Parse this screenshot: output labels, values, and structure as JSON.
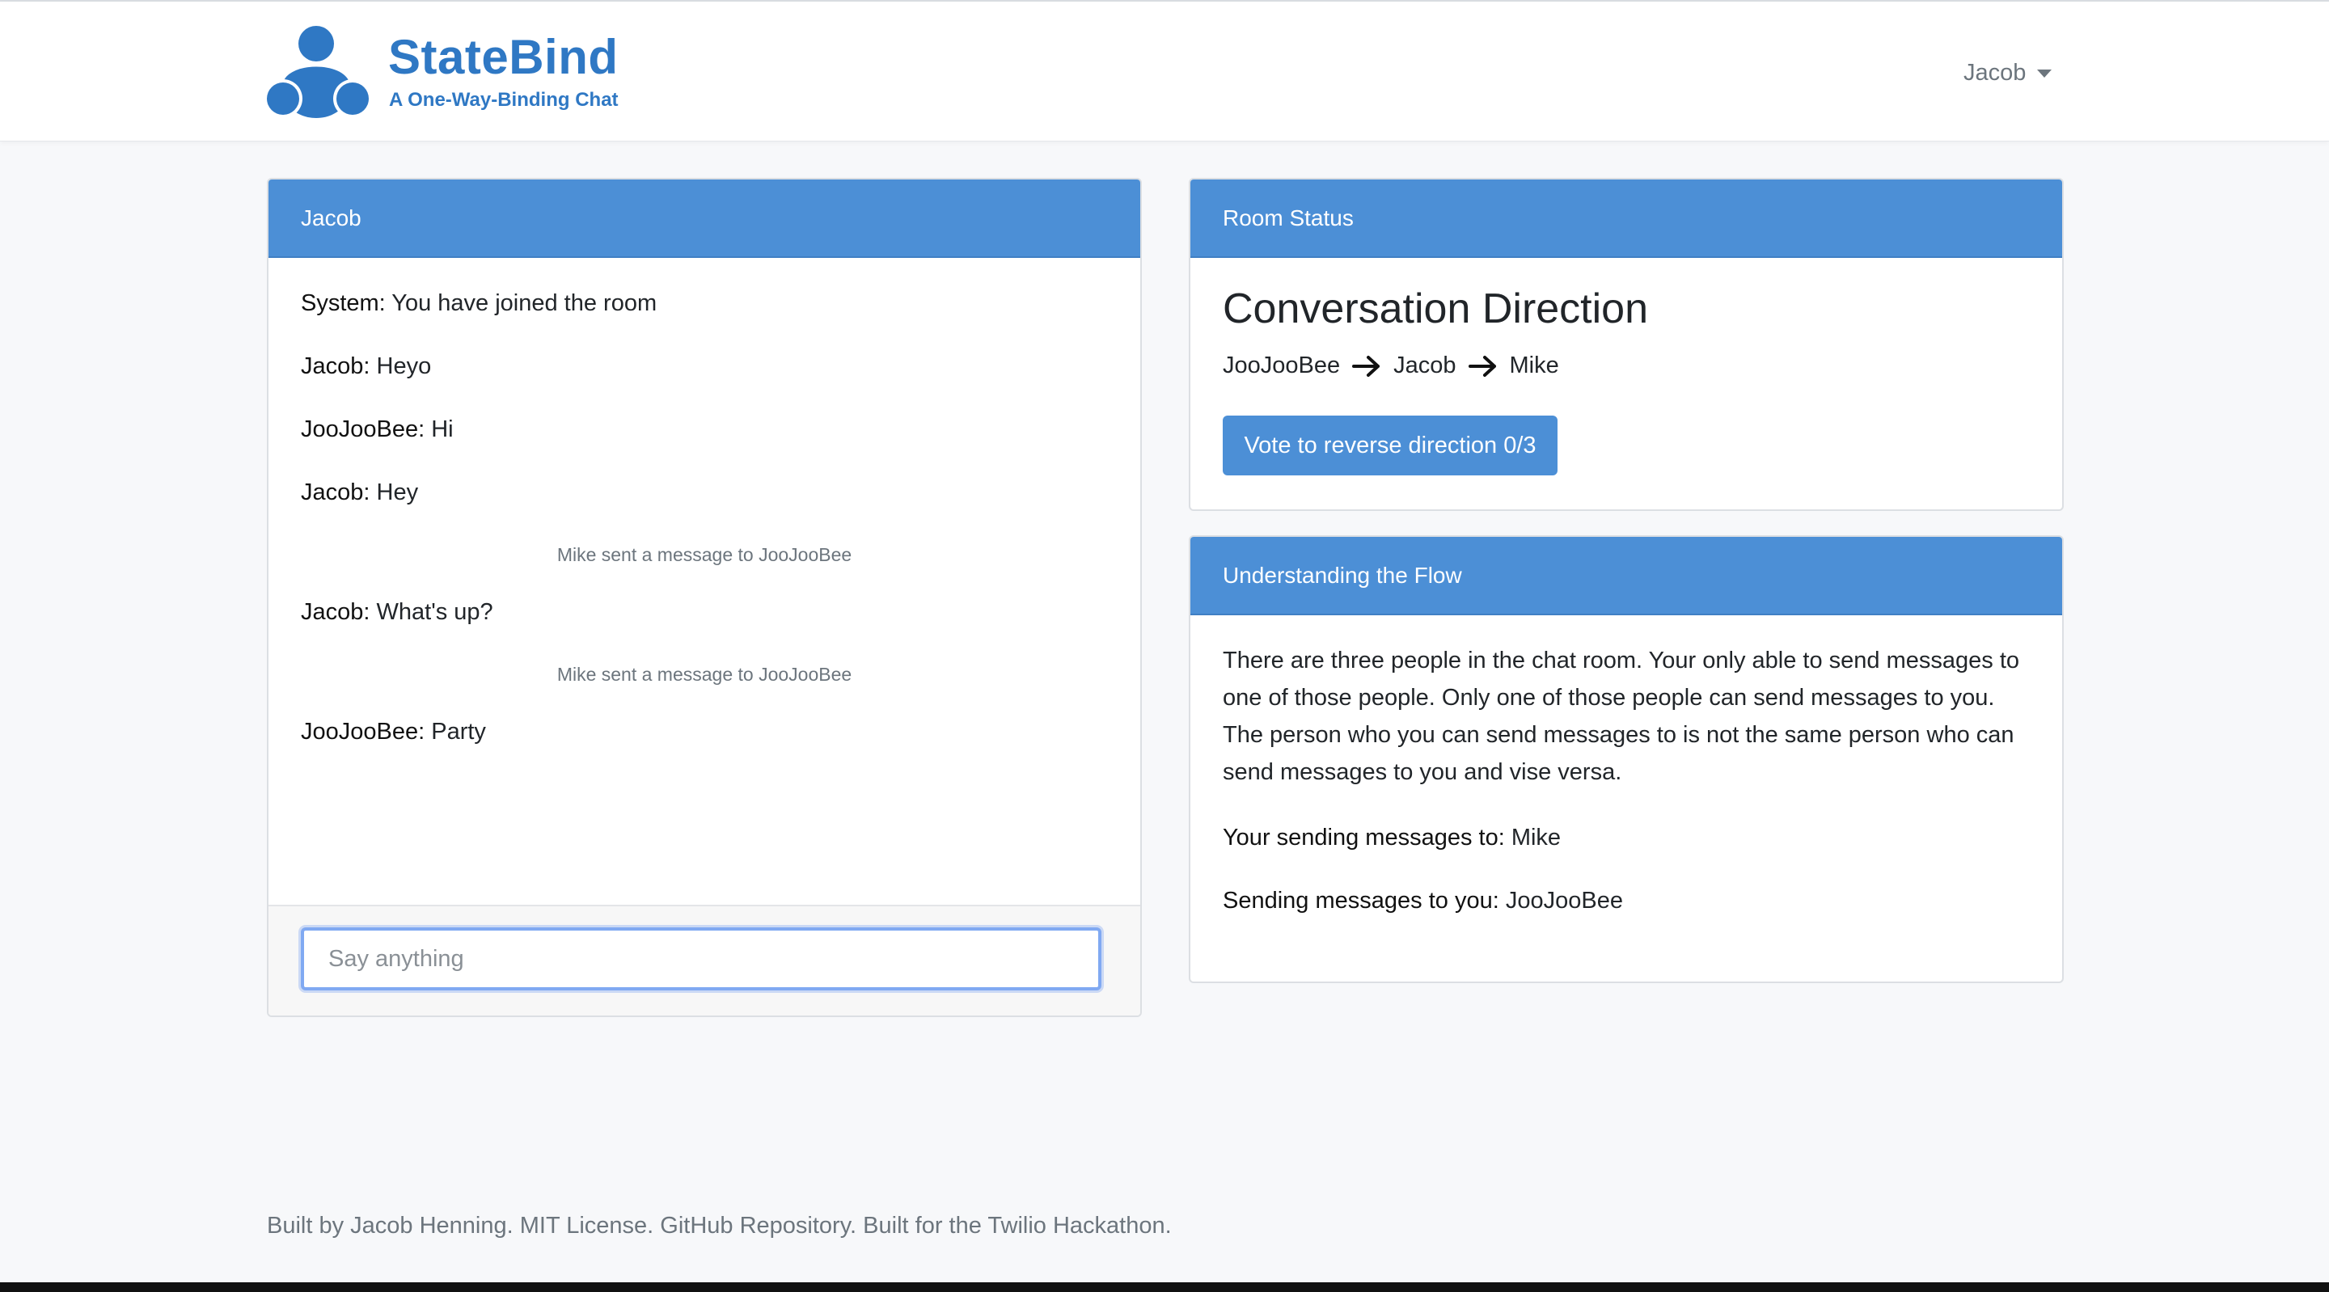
{
  "brand": {
    "name": "StateBind",
    "tagline": "A One-Way-Binding Chat",
    "color": "#2f78c4"
  },
  "nav": {
    "user": "Jacob",
    "user_icon": "chevron-down-icon"
  },
  "chat": {
    "header": "Jacob",
    "messages": [
      {
        "sender": "System:",
        "text": " You have joined the room"
      },
      {
        "sender": "Jacob:",
        "text": " Heyo"
      },
      {
        "sender": "JooJooBee:",
        "text": " Hi"
      },
      {
        "sender": "Jacob:",
        "text": " Hey"
      },
      {
        "note": "Mike sent a message to JooJooBee"
      },
      {
        "sender": "Jacob:",
        "text": " What's up?"
      },
      {
        "note": "Mike sent a message to JooJooBee"
      },
      {
        "sender": "JooJooBee:",
        "text": " Party"
      }
    ],
    "input_placeholder": "Say anything",
    "input_value": ""
  },
  "room_status": {
    "header": "Room Status",
    "title": "Conversation Direction",
    "direction": [
      "JooJooBee",
      "Jacob",
      "Mike"
    ],
    "vote_button": "Vote to reverse direction 0/3"
  },
  "flow": {
    "header": "Understanding the Flow",
    "description": "There are three people in the chat room. Your only able to send messages to one of those people. Only one of those people can send messages to you. The person who you can send messages to is not the same person who can send messages to you and vise versa.",
    "sending_to_label": "Your sending messages to:",
    "sending_to_value": " Mike",
    "receiving_from_label": "Sending messages to you:",
    "receiving_from_value": " JooJooBee"
  },
  "footer": {
    "text": "Built by Jacob Henning. MIT License. GitHub Repository. Built for the Twilio Hackathon."
  },
  "colors": {
    "accent": "#4c8fd6",
    "background": "#f7f8fa"
  }
}
